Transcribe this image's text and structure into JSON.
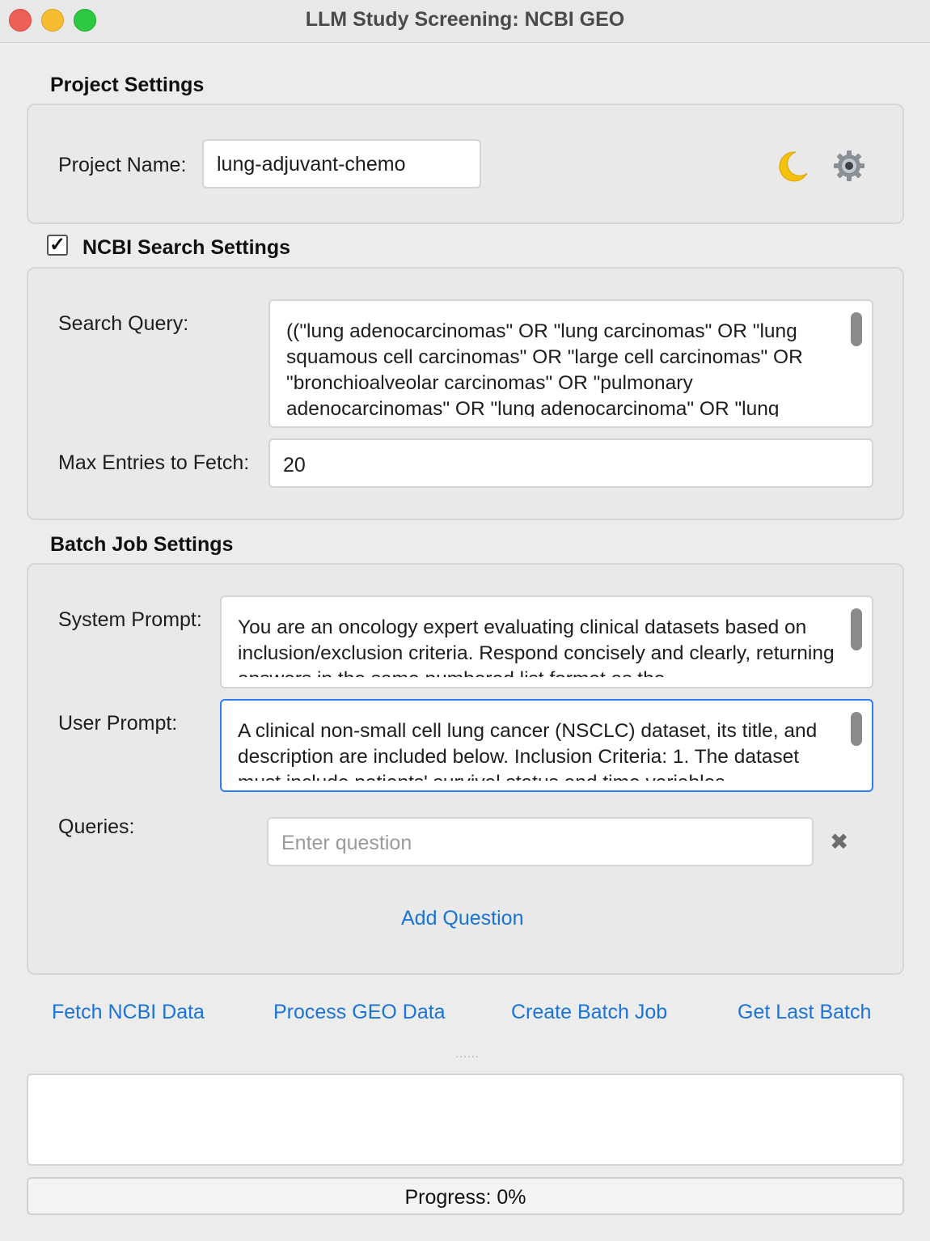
{
  "window": {
    "title": "LLM Study Screening: NCBI GEO"
  },
  "project": {
    "section_title": "Project Settings",
    "name_label": "Project Name:",
    "name_value": "lung-adjuvant-chemo",
    "icons": [
      "crescent-moon-icon",
      "gear-icon"
    ]
  },
  "ncbi": {
    "enabled": true,
    "check_mark": "✓",
    "section_title": "NCBI Search Settings",
    "query_label": "Search Query:",
    "query_value": "((\"lung adenocarcinomas\" OR \"lung carcinomas\" OR \"lung squamous cell carcinomas\" OR \"large cell carcinomas\" OR \"bronchioalveolar carcinomas\" OR \"pulmonary adenocarcinomas\" OR \"lung adenocarcinoma\" OR \"lung",
    "max_label": "Max Entries to Fetch:",
    "max_value": "20"
  },
  "batch": {
    "section_title": "Batch Job Settings",
    "system_label": "System Prompt:",
    "system_value": "You are an oncology expert evaluating clinical datasets based on inclusion/exclusion criteria. Respond concisely and clearly, returning answers in the same numbered list format as the",
    "user_label": "User Prompt:",
    "user_value": "A clinical non-small cell lung cancer (NSCLC) dataset, its title, and description are included below. Inclusion Criteria:  1. The dataset must include patients' survival status and time variables",
    "queries_label": "Queries:",
    "query_placeholder": "Enter question",
    "remove_glyph": "✖",
    "add_question": "Add Question"
  },
  "actions": {
    "fetch": "Fetch NCBI Data",
    "process": "Process GEO Data",
    "create": "Create Batch Job",
    "last": "Get Last Batch"
  },
  "splitter": "......",
  "log_text": "",
  "progress": {
    "label": "Progress: 0%",
    "value": 0
  },
  "colors": {
    "accent": "#1a73d9",
    "focus": "#2e7cf6"
  }
}
